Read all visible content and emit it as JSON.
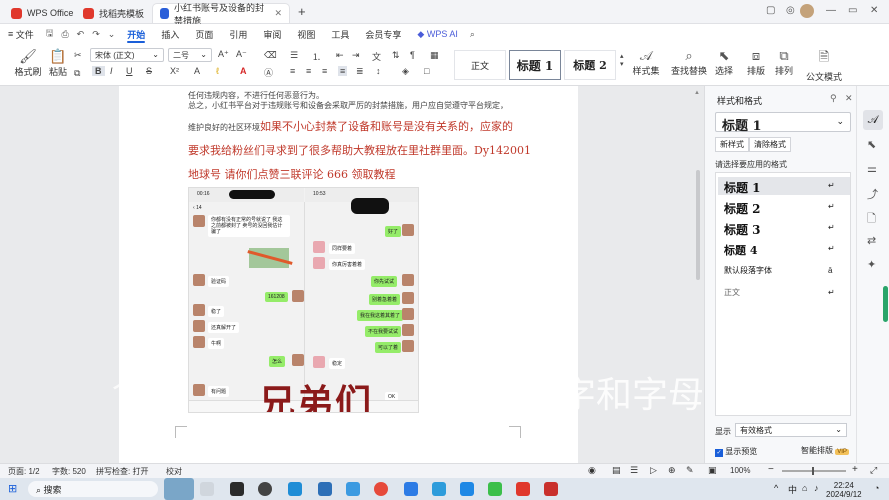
{
  "titlebar": {
    "tabs": [
      {
        "label": "WPS Office",
        "color": "#e0382c"
      },
      {
        "label": "找稻壳模板",
        "color": "#e0382c"
      },
      {
        "label": "小红书账号及设备的封禁措施",
        "color": "#2b5fd9"
      }
    ],
    "new_tab": "+"
  },
  "menubar": {
    "file": "文件",
    "items": [
      "开始",
      "插入",
      "页面",
      "引用",
      "审阅",
      "视图",
      "工具",
      "会员专享"
    ],
    "active": "开始",
    "wps_ai": "WPS AI",
    "share": "分享"
  },
  "ribbon": {
    "format_painter": "格式刷",
    "paste": "粘贴",
    "font_name": "宋体 (正文)",
    "font_size": "二号",
    "style_normal": "正文",
    "style_h1": "标题 1",
    "style_h2": "标题 2",
    "style_set": "样式集",
    "find_replace": "查找替换",
    "select": "选择",
    "sort": "排版",
    "arrange": "排列",
    "doc_formula": "公文模式"
  },
  "document": {
    "line1": "任何违规内容，不进行任何恶意行为。",
    "line2": "总之，小红书平台对于违规账号和设备会采取严厉的封禁措施，用户应自觉遵守平台规定，",
    "line3_prefix": "维护良好的社区环境",
    "line3_red": "如果不小心封禁了设备和账号是没有关系的，应家的",
    "line4": "要求我给粉丝们寻求到了很多帮助大教程放在里社群里面。Dy142001",
    "line5": "地球号    请你们点赞三联评论 666 领取教程"
  },
  "phone": {
    "time_left": "00:16",
    "time_right": "10:53",
    "back_count": "14",
    "bubbles": [
      "你都有没有正常的号就说了 我这之前都被封了 卖号的没回我估计骗了",
      "好了",
      "同样要着",
      "你真厉害着着",
      "验证码",
      "你先试试",
      "161208",
      "别着急着着",
      "我在我这着其着了",
      "稳了",
      "还真解开了",
      "不在我要试试",
      "牛啊",
      "可以了着",
      "怎么",
      "稳定",
      "OK",
      "有问题"
    ],
    "overlay_text": "兄弟们"
  },
  "overlay": {
    "big_text": "兄弟们",
    "right_text": "字和字母",
    "left_char": "个"
  },
  "pane": {
    "title": "样式和格式",
    "current_style": "标题 1",
    "new_style": "新样式",
    "clear_format": "清除格式",
    "apply_label": "请选择要应用的格式",
    "styles": [
      "标题 1",
      "标题 2",
      "标题 3",
      "标题 4",
      "默认段落字体",
      "正文"
    ],
    "show_label": "显示",
    "show_value": "有效格式",
    "preview_label": "显示预览",
    "smart_sort": "智能排版"
  },
  "status": {
    "page": "页面: 1/2",
    "words": "字数: 520",
    "spell": "拼写检查: 打开",
    "proof": "校对",
    "zoom": "100%"
  },
  "taskbar": {
    "search": "搜索",
    "time": "22:24",
    "date": "2024/9/12",
    "ime": "中"
  }
}
